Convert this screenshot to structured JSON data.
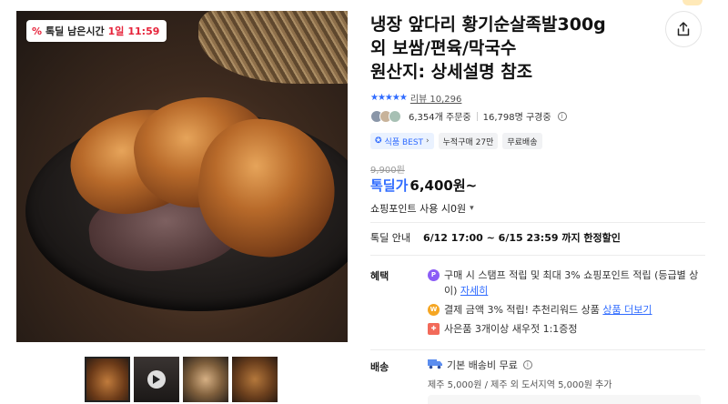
{
  "gallery": {
    "timer_badge": {
      "label": "톡딜 남은시간",
      "days": "1일",
      "time": "11:59"
    },
    "thumbnails": [
      {
        "name": "thumbnail-1",
        "active": true
      },
      {
        "name": "thumbnail-2-video",
        "active": false
      },
      {
        "name": "thumbnail-3",
        "active": false
      },
      {
        "name": "thumbnail-4",
        "active": false
      }
    ]
  },
  "product": {
    "title_lines": [
      "냉장 앞다리 황기순살족발300g",
      "외 보쌈/편육/막국수",
      "원산지: 상세설명 참조"
    ],
    "stars": "★★★★★",
    "review_label": "리뷰 10,296",
    "orders": "6,354개 주문중",
    "subscribers": "16,798명 구경중",
    "tags": [
      "식품 BEST",
      "누적구매 27만",
      "무료배송"
    ],
    "original_price": "9,900원",
    "price_label": "톡딜가",
    "price": "6,400원~",
    "point_use": "쇼핑포인트 사용 시0원"
  },
  "deal": {
    "label": "톡딜 안내",
    "text": "6/12 17:00 ~ 6/15 23:59 까지 한정할인"
  },
  "benefits": {
    "label": "혜택",
    "items": [
      {
        "icon": "point-icon",
        "text": "구매 시 스탬프 적립 및 최대 3% 쇼핑포인트 적립 (등급별 상이)",
        "link": "자세히"
      },
      {
        "icon": "won-coin-icon",
        "text": "결제 금액 3% 적립! 추천리워드 상품",
        "link": "상품 더보기"
      },
      {
        "icon": "gift-icon",
        "text": "사은품 3개이상 새우젓 1:1증정",
        "link": ""
      }
    ]
  },
  "shipping": {
    "label": "배송",
    "line": "기본 배송비 무료",
    "extra": "제주 5,000원 / 제주 외 도서지역 5,000원 추가"
  },
  "colors": {
    "accent_blue": "#2f6bff",
    "timer_red": "#e6243b"
  }
}
